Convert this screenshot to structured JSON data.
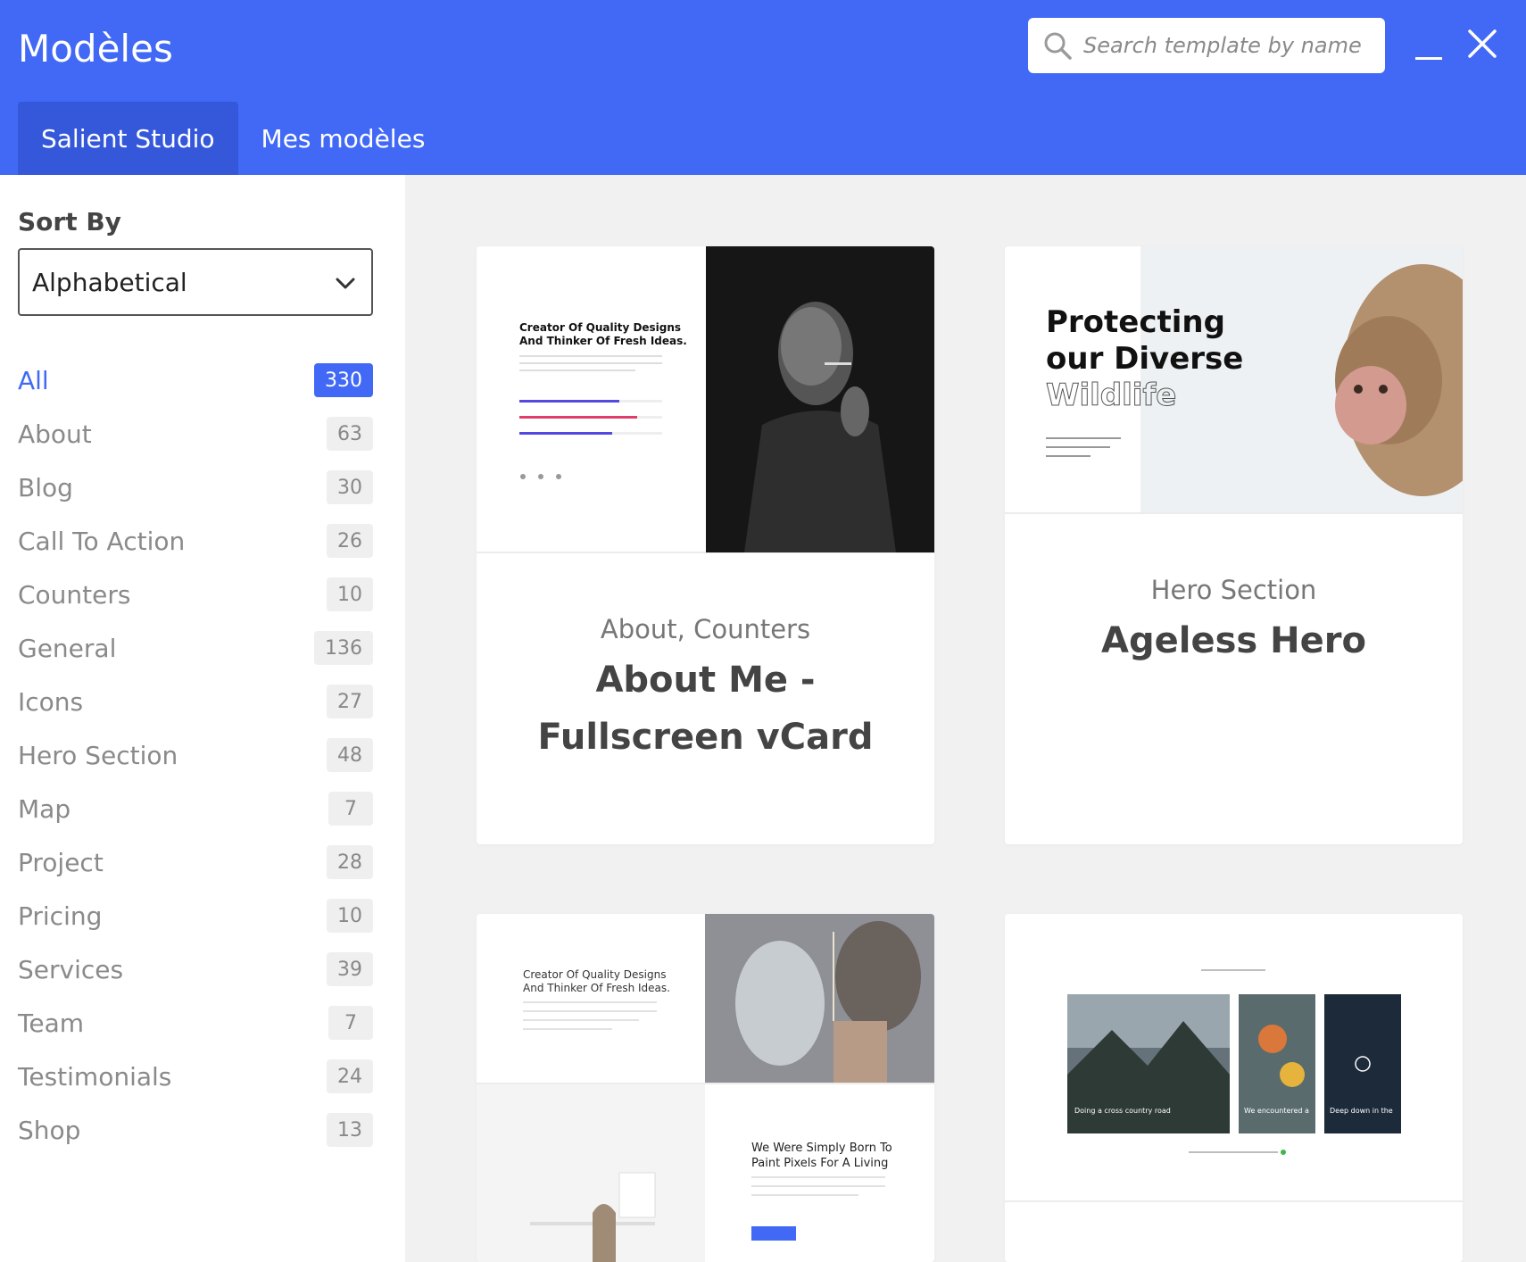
{
  "header": {
    "title": "Modèles",
    "search_placeholder": "Search template by name",
    "tabs": [
      {
        "label": "Salient Studio"
      },
      {
        "label": "Mes modèles"
      }
    ]
  },
  "sidebar": {
    "sort_label": "Sort By",
    "sort_value": "Alphabetical",
    "categories": [
      {
        "name": "All",
        "count": "330"
      },
      {
        "name": "About",
        "count": "63"
      },
      {
        "name": "Blog",
        "count": "30"
      },
      {
        "name": "Call To Action",
        "count": "26"
      },
      {
        "name": "Counters",
        "count": "10"
      },
      {
        "name": "General",
        "count": "136"
      },
      {
        "name": "Icons",
        "count": "27"
      },
      {
        "name": "Hero Section",
        "count": "48"
      },
      {
        "name": "Map",
        "count": "7"
      },
      {
        "name": "Project",
        "count": "28"
      },
      {
        "name": "Pricing",
        "count": "10"
      },
      {
        "name": "Services",
        "count": "39"
      },
      {
        "name": "Team",
        "count": "7"
      },
      {
        "name": "Testimonials",
        "count": "24"
      },
      {
        "name": "Shop",
        "count": "13"
      }
    ]
  },
  "cards": [
    {
      "categories": "About, Counters",
      "title_line1": "About Me -",
      "title_line2": "Fullscreen vCard",
      "preview": {
        "heading_line1": "Creator Of Quality Designs",
        "heading_line2": "And Thinker Of Fresh Ideas."
      }
    },
    {
      "categories": "Hero Section",
      "title": "Ageless Hero",
      "preview": {
        "heading_line1": "Protecting",
        "heading_line2": "our Diverse",
        "heading_line3": "Wildlife"
      }
    },
    {
      "preview": {
        "heading_line1": "Creator Of Quality Designs",
        "heading_line2": "And Thinker Of Fresh Ideas.",
        "story_line1": "We Were Simply Born To",
        "story_line2": "Paint Pixels For A Living"
      }
    },
    {
      "preview": {
        "caption1": "Doing a cross country road",
        "caption2": "We encountered a",
        "caption3": "Deep down in the"
      }
    }
  ],
  "colors": {
    "accent": "#4169f5",
    "accent_dark": "#3558db"
  }
}
